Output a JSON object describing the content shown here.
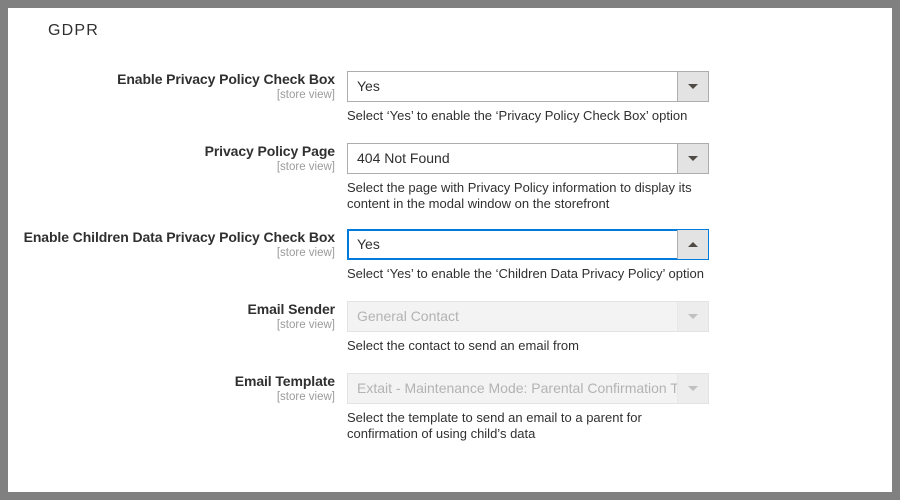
{
  "section": {
    "title": "GDPR"
  },
  "fields": [
    {
      "label": "Enable Privacy Policy Check Box",
      "scope": "[store view]",
      "value": "Yes",
      "help": "Select ‘Yes’ to enable the ‘Privacy Policy Check Box’ option",
      "state": "normal",
      "arrow": "chevron-down-icon"
    },
    {
      "label": "Privacy Policy Page",
      "scope": "[store view]",
      "value": "404 Not Found",
      "help": "Select the page with Privacy Policy information to display its content in the modal window on the storefront",
      "state": "normal",
      "arrow": "chevron-down-icon"
    },
    {
      "label": "Enable Children Data Privacy Policy Check Box",
      "scope": "[store view]",
      "value": "Yes",
      "help": "Select ‘Yes’ to enable the ‘Children Data Privacy Policy’ option",
      "state": "focused",
      "arrow": "chevron-up-icon"
    },
    {
      "label": "Email Sender",
      "scope": "[store view]",
      "value": "General Contact",
      "help": "Select the contact to send an email from",
      "state": "disabled",
      "arrow": "chevron-down-icon"
    },
    {
      "label": "Email Template",
      "scope": "[store view]",
      "value": "Extait - Maintenance Mode: Parental Confirmation Ten",
      "help": "Select the template to send an email to a parent for confirmation of using child’s data",
      "state": "disabled",
      "arrow": "chevron-down-icon"
    }
  ],
  "colors": {
    "page_border": "#808080",
    "content_bg": "#ffffff",
    "focus_border": "#007bdb",
    "text": "#303030",
    "scope_text": "#9b9b9b",
    "disabled_text": "#b3b3b3"
  },
  "layout": {
    "row_tops": [
      63,
      135,
      221,
      293,
      365
    ]
  }
}
